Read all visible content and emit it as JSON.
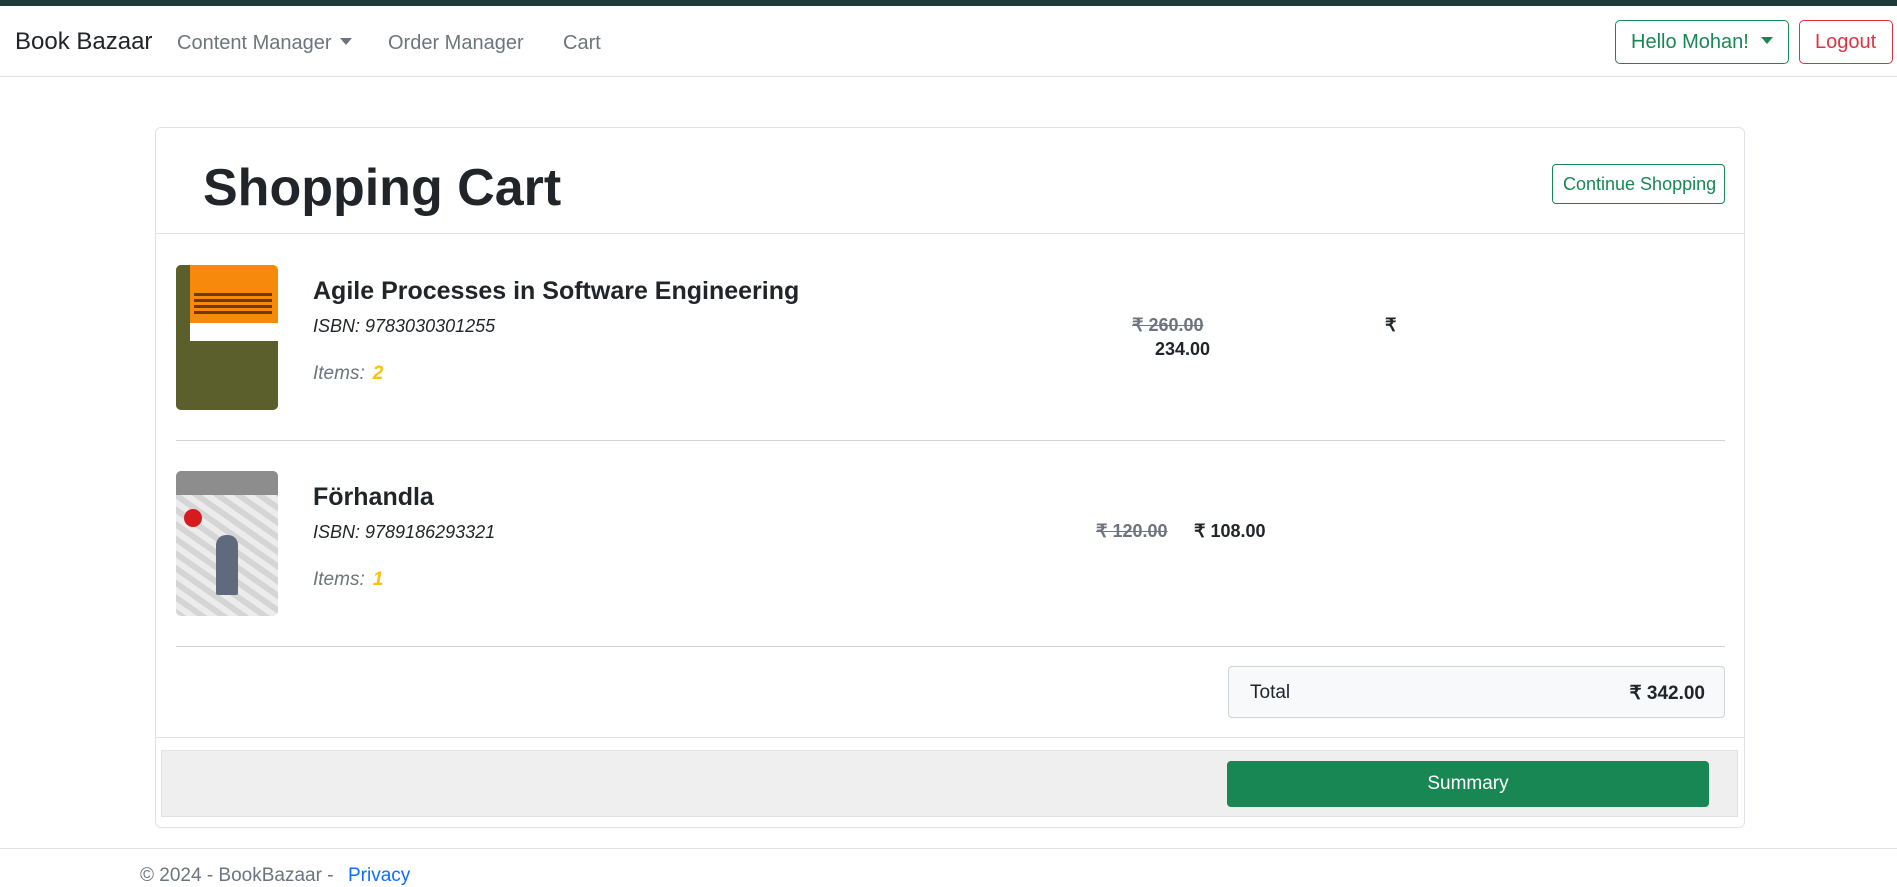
{
  "navbar": {
    "brand": "Book Bazaar",
    "links": [
      "Content Manager",
      "Order Manager",
      "Cart"
    ],
    "user_menu": "Hello Mohan!",
    "logout": "Logout"
  },
  "cart": {
    "title": "Shopping Cart",
    "continue_label": "Continue Shopping",
    "items": [
      {
        "title": "Agile Processes in Software Engineering",
        "isbn": "ISBN: 9783030301255",
        "qty_label": "Items:",
        "qty": "2",
        "list_price": "₹ 260.00",
        "price": "₹ 234.00",
        "price_part1": "₹",
        "price_part2": "234.00",
        "cover_icon": "book-cover-agile"
      },
      {
        "title": "Förhandla",
        "isbn": "ISBN: 9789186293321",
        "qty_label": "Items:",
        "qty": "1",
        "list_price": "₹ 120.00",
        "price": "₹ 108.00",
        "cover_icon": "book-cover-forhandla"
      }
    ],
    "total_label": "Total",
    "total_value": "₹ 342.00",
    "summary_label": "Summary"
  },
  "footer": {
    "copyright": "© 2024 - BookBazaar - ",
    "privacy": "Privacy"
  },
  "colors": {
    "success": "#198754",
    "danger": "#dc3545",
    "warning": "#ffc107"
  }
}
